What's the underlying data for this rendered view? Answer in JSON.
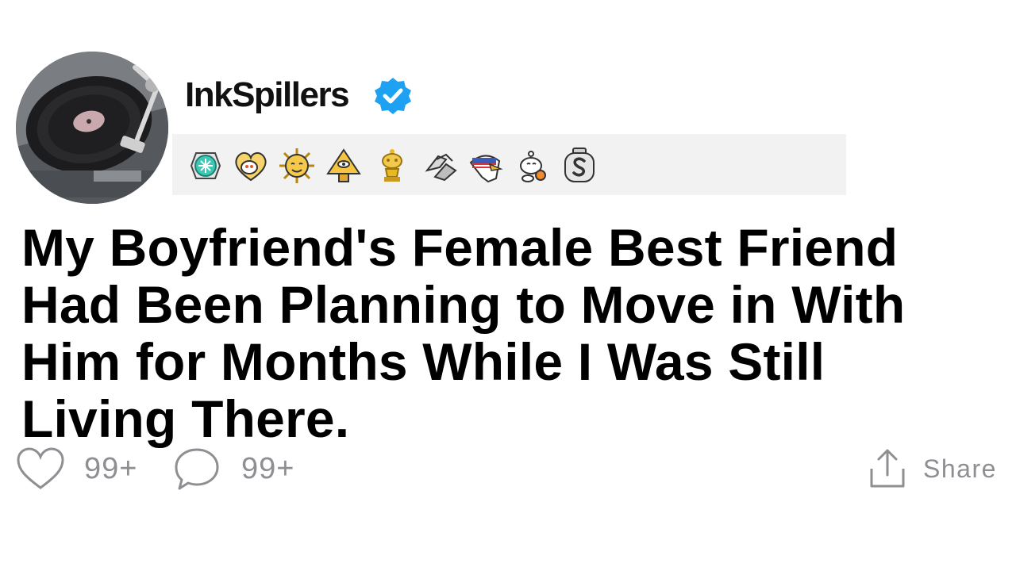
{
  "post": {
    "username": "InkSpillers",
    "verified": true,
    "title": "My Boyfriend's Female Best Friend Had Been Planning to Move in With Him for Months While I Was Still Living There."
  },
  "awards": [
    {
      "icon": "teal-medal-award-icon"
    },
    {
      "icon": "heart-snoo-award-icon"
    },
    {
      "icon": "sun-face-award-icon"
    },
    {
      "icon": "golden-pyramid-award-icon"
    },
    {
      "icon": "gold-snoo-trophy-award-icon"
    },
    {
      "icon": "handshake-award-icon"
    },
    {
      "icon": "eagle-award-icon"
    },
    {
      "icon": "snoo-shaking-award-icon"
    },
    {
      "icon": "silver-s-medal-award-icon"
    }
  ],
  "actions": {
    "likes": "99+",
    "comments": "99+",
    "share": "Share"
  },
  "colors": {
    "verified": "#1da1f2",
    "muted": "#8e8e93",
    "awards_bg": "#f2f2f2"
  }
}
